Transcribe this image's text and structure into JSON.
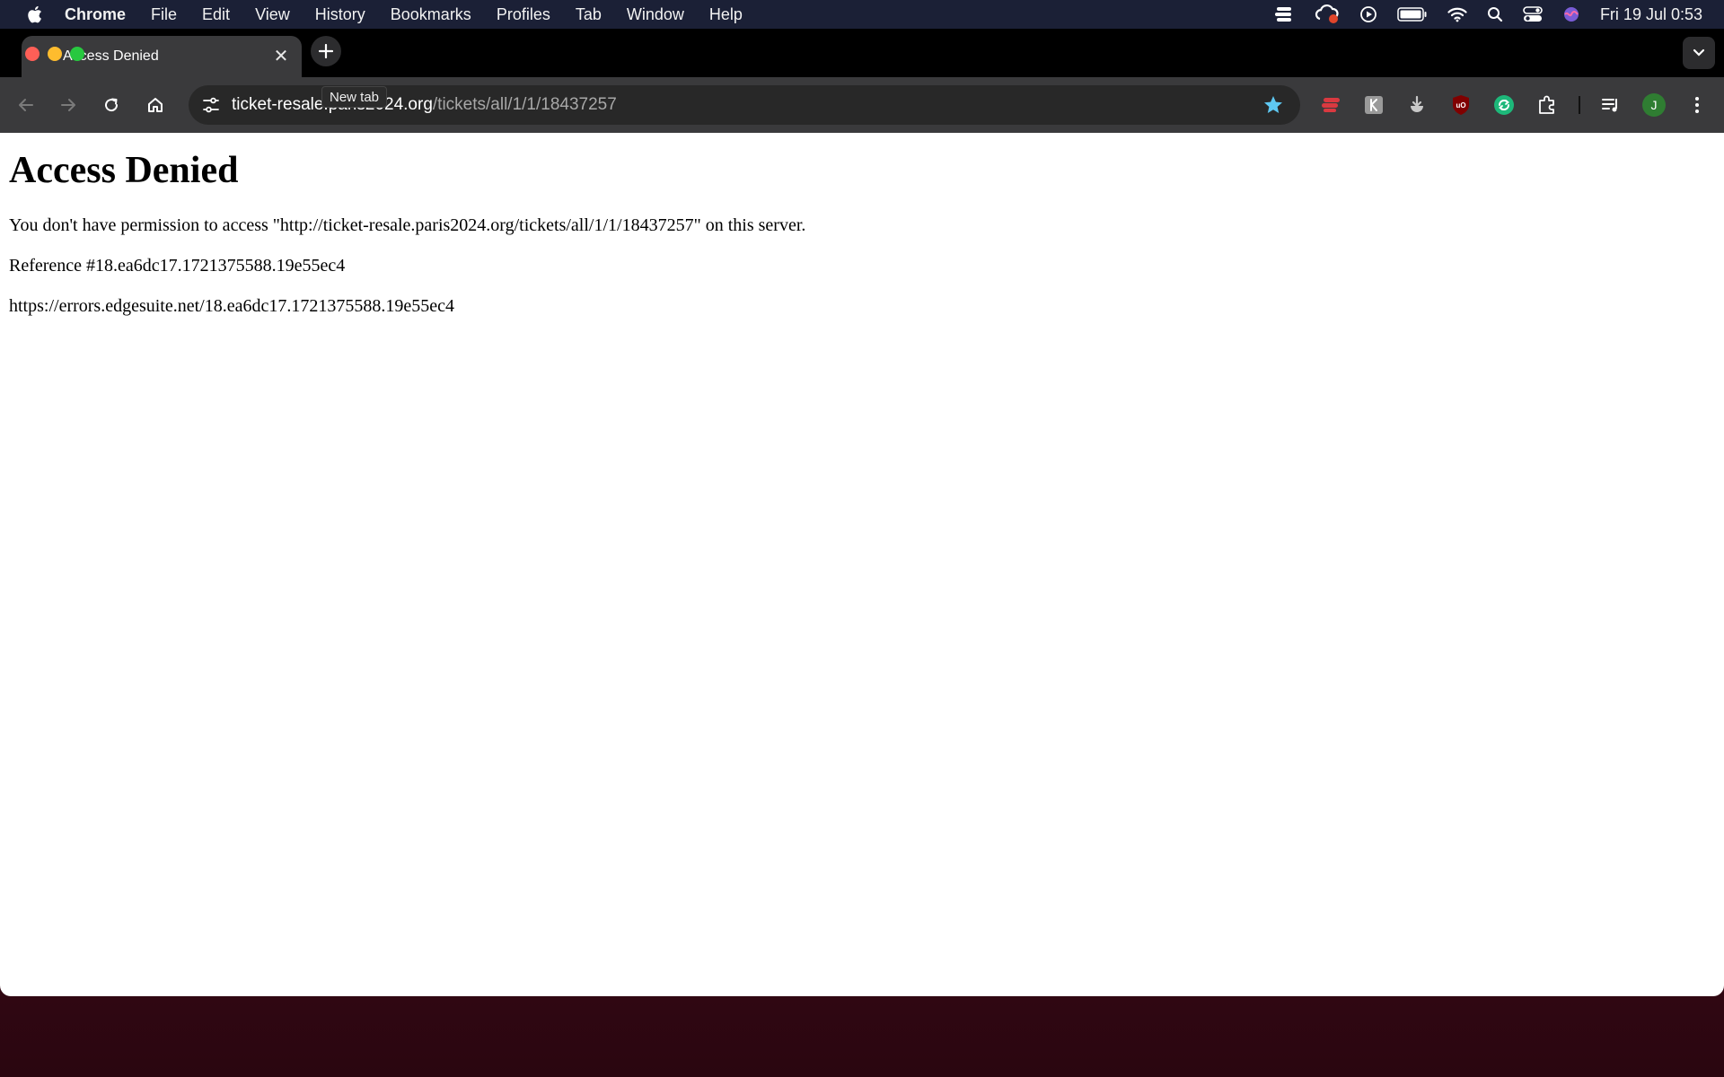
{
  "menubar": {
    "app_name": "Chrome",
    "items": [
      "File",
      "Edit",
      "View",
      "History",
      "Bookmarks",
      "Profiles",
      "Tab",
      "Window",
      "Help"
    ],
    "clock": "Fri 19 Jul  0:53"
  },
  "tab": {
    "title": "Access Denied",
    "close_glyph": "✕"
  },
  "tooltip": {
    "text": "New tab"
  },
  "omnibox": {
    "host": "ticket-resale.paris2024.org",
    "path": "/tickets/all/1/1/18437257"
  },
  "profile": {
    "initial": "J"
  },
  "page": {
    "heading": "Access Denied",
    "message": "You don't have permission to access \"http://ticket-resale.paris2024.org/tickets/all/1/1/18437257\" on this server.",
    "reference": "Reference #18.ea6dc17.1721375588.19e55ec4",
    "error_url": "https://errors.edgesuite.net/18.ea6dc17.1721375588.19e55ec4"
  },
  "colors": {
    "menubar_bg": "#1b2036",
    "toolbar_bg": "#3a3a3c",
    "star": "#5ec8f2"
  }
}
